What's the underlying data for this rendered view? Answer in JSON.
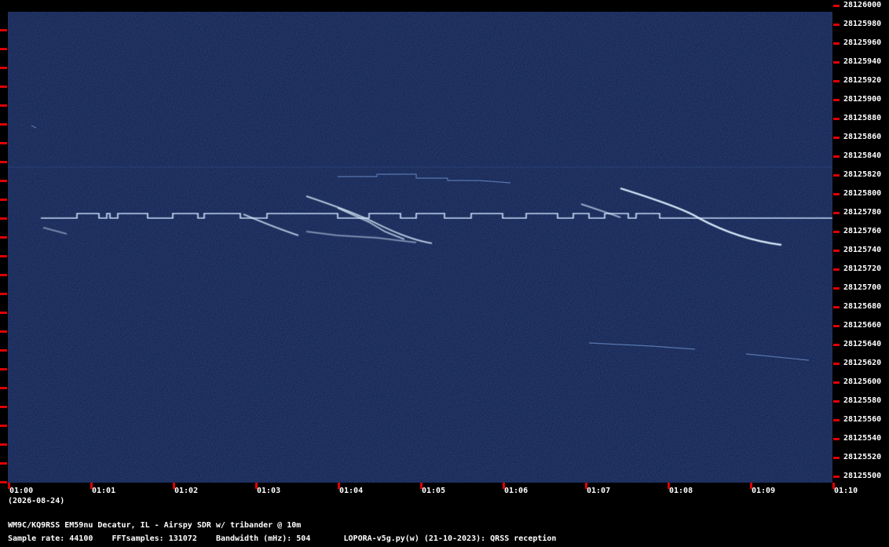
{
  "station": "WM9C/KQ9RSS EM59nu Decatur, IL - Airspy SDR w/ tribander @ 10m",
  "info": {
    "sample_rate": "Sample rate: 44100",
    "fft_samples": "FFTsamples: 131072",
    "bandwidth": "Bandwidth (mHz): 504",
    "software": "LOPORA-v5g.py(w) (21-10-2023): QRSS reception"
  },
  "date": "(2026-08-24)",
  "time_labels": [
    "01:00",
    "01:01",
    "01:02",
    "01:03",
    "01:04",
    "01:05",
    "01:06",
    "01:07",
    "01:08",
    "01:09",
    "01:10"
  ],
  "freq_labels": [
    "28126000",
    "28125980",
    "28125960",
    "28125940",
    "28125920",
    "28125900",
    "28125880",
    "28125860",
    "28125840",
    "28125820",
    "28125800",
    "28125780",
    "28125760",
    "28125740",
    "28125720",
    "28125700",
    "28125680",
    "28125660",
    "28125640",
    "28125620",
    "28125600",
    "28125580",
    "28125560",
    "28125540",
    "28125520",
    "28125500"
  ],
  "colors": {
    "background": "#0d1d4a",
    "signal": "#bfe0ff",
    "tick": "#e00000"
  }
}
